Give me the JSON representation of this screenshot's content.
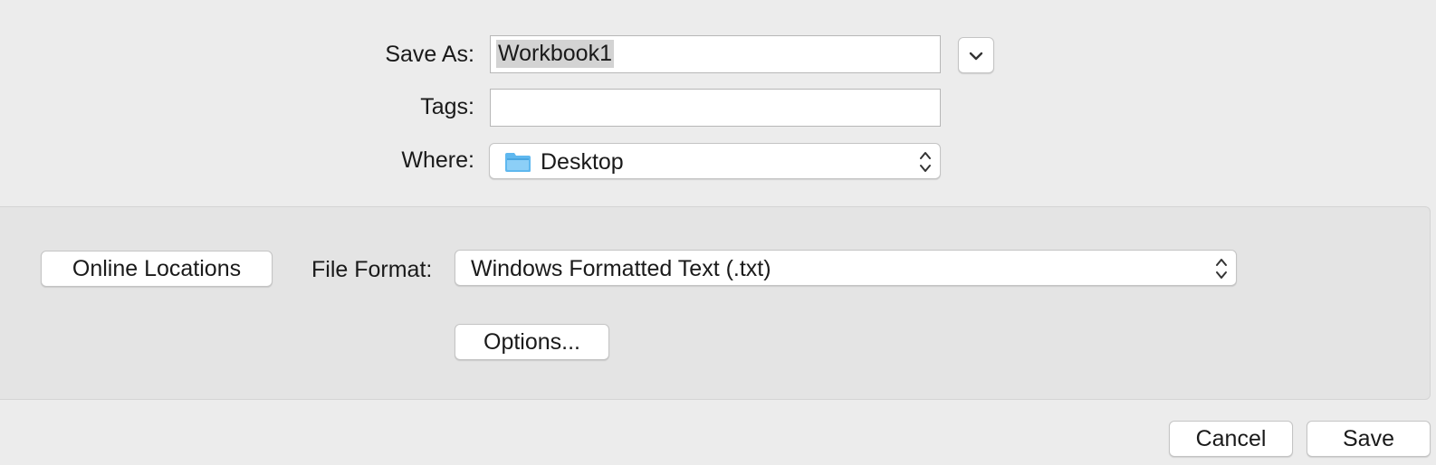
{
  "form": {
    "save_as_label": "Save As:",
    "save_as_value": "Workbook1",
    "tags_label": "Tags:",
    "tags_value": "",
    "where_label": "Where:",
    "where_value": "Desktop"
  },
  "options_panel": {
    "online_locations_label": "Online Locations",
    "file_format_label": "File Format:",
    "file_format_value": "Windows Formatted Text (.txt)",
    "options_button_label": "Options..."
  },
  "footer": {
    "cancel_label": "Cancel",
    "save_label": "Save"
  },
  "icons": {
    "expand": "chevron-down-icon",
    "popup": "up-down-chevron-icon",
    "location": "folder-icon"
  },
  "colors": {
    "background": "#ececec",
    "panel": "#e4e4e4",
    "folder": "#5fb8ef",
    "selection": "#d3d3d3"
  }
}
